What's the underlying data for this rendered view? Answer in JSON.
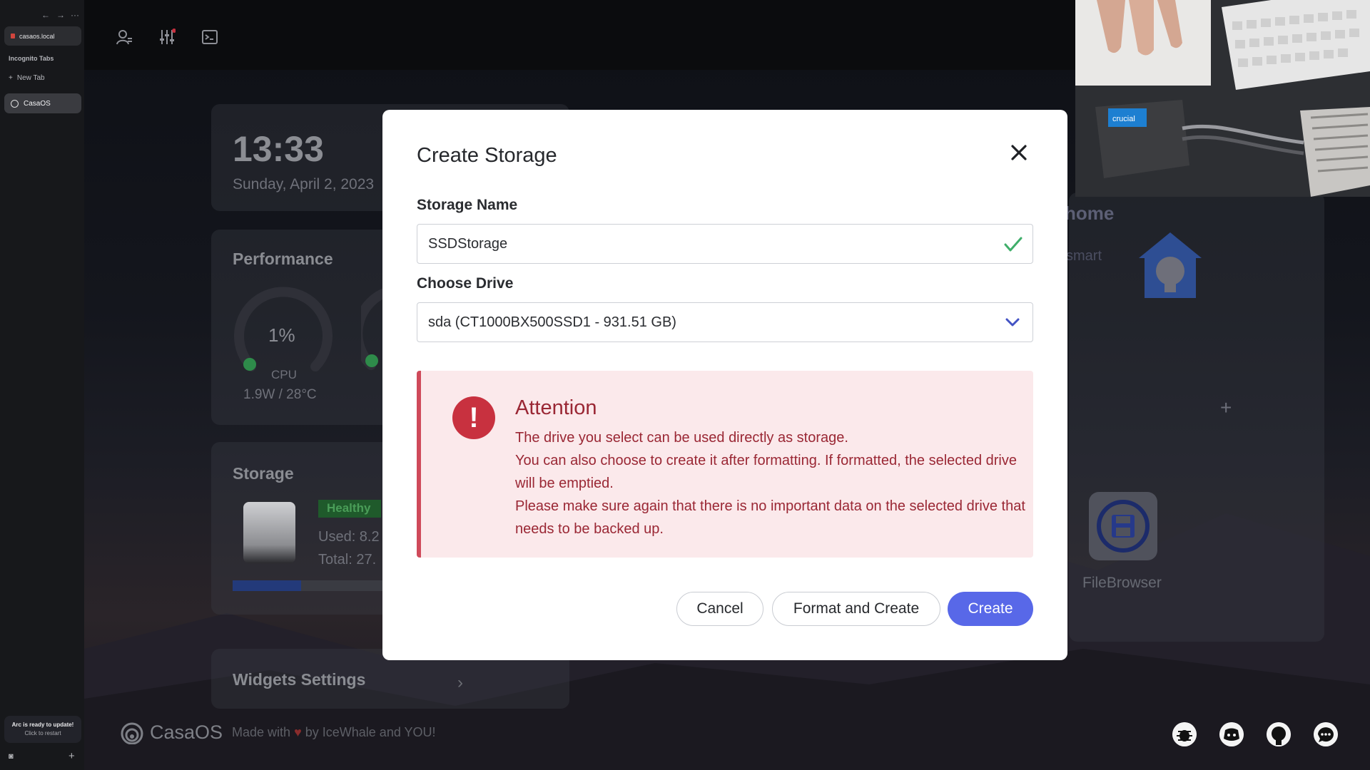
{
  "browser": {
    "url": "casaos.local",
    "section_label": "Incognito Tabs",
    "new_tab_label": "New Tab",
    "active_tab": "CasaOS",
    "update_title": "Arc is ready to update!",
    "update_sub": "Click to restart"
  },
  "dashboard": {
    "time": "13:33",
    "date": "Sunday, April 2, 2023",
    "performance_title": "Performance",
    "cpu_percent": "1%",
    "cpu_label": "CPU",
    "cpu_info": "1.9W / 28°C",
    "storage_title": "Storage",
    "storage_status": "Healthy",
    "storage_used": "Used: 8.2",
    "storage_total": "Total: 27.",
    "widgets_settings": "Widgets Settings",
    "brand": "CasaOS",
    "made_with_prefix": "Made with",
    "made_with_suffix": "by IceWhale and YOU!",
    "smart_title": "home",
    "smart_sub": "smart",
    "app_filebrowser": "FileBrowser"
  },
  "modal": {
    "title": "Create Storage",
    "storage_name_label": "Storage Name",
    "storage_name_value": "SSDStorage",
    "choose_drive_label": "Choose Drive",
    "drive_selected": "sda (CT1000BX500SSD1 - 931.51 GB)",
    "attention_title": "Attention",
    "attention_lines": [
      "The drive you select can be used directly as storage.",
      "You can also choose to create it after formatting. If formatted, the selected drive will be emptied.",
      "Please make sure again that there is no important data on the selected drive that needs to be backed up."
    ],
    "cancel_label": "Cancel",
    "format_label": "Format and Create",
    "create_label": "Create"
  },
  "colors": {
    "primary": "#5868e8",
    "danger": "#c8313f",
    "valid": "#3fae6a"
  },
  "webcam": {
    "product_label": "crucial"
  }
}
